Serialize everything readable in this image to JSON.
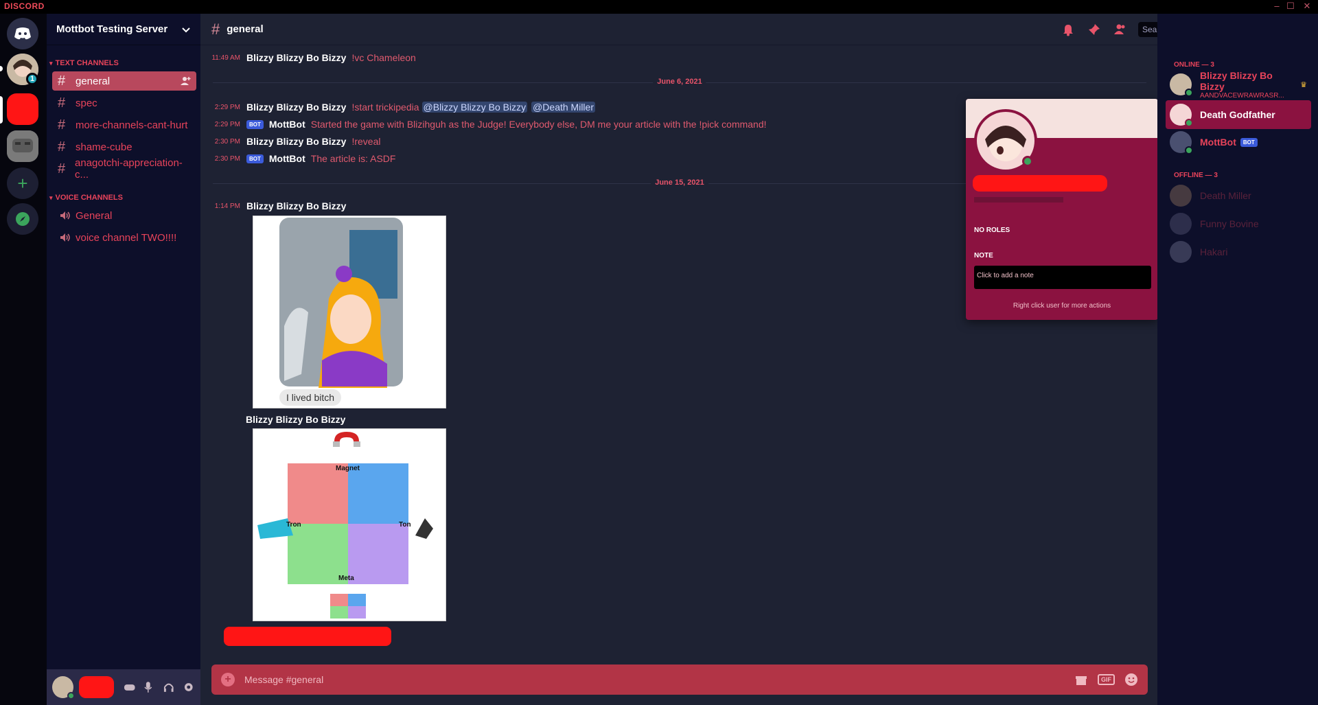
{
  "titlebar": {
    "app_name": "DISCORD"
  },
  "server": {
    "name": "Mottbot Testing Server",
    "mention_badge": "1"
  },
  "sidebar": {
    "text_category": "TEXT CHANNELS",
    "text_channels": [
      "general",
      "spec",
      "more-channels-cant-hurt",
      "shame-cube",
      "anagotchi-appreciation-c..."
    ],
    "voice_category": "VOICE CHANNELS",
    "voice_channels": [
      "General",
      "voice channel TWO!!!!"
    ]
  },
  "channel_header": {
    "name": "general",
    "search_placeholder": "Search"
  },
  "messages": {
    "m0": {
      "time": "11:49 AM",
      "author": "Blizzy Blizzy Bo Bizzy",
      "text": "!vc Chameleon"
    },
    "divider1": "June 6, 2021",
    "m1": {
      "time": "2:29 PM",
      "author": "Blizzy Blizzy Bo Bizzy",
      "text": "!start trickipedia",
      "mention1": "@Blizzy Blizzy Bo Bizzy",
      "mention2": "@Death Miller"
    },
    "m2": {
      "time": "2:29 PM",
      "badge": "BOT",
      "author": "MottBot",
      "text": "Started the game with Blizihguh as the Judge! Everybody else, DM me your article with the !pick command!"
    },
    "m3": {
      "time": "2:30 PM",
      "author": "Blizzy Blizzy Bo Bizzy",
      "text": "!reveal"
    },
    "m4": {
      "time": "2:30 PM",
      "badge": "BOT",
      "author": "MottBot",
      "text": "The article is: ASDF"
    },
    "divider2": "June 15, 2021",
    "m5": {
      "time": "1:14 PM",
      "author": "Blizzy Blizzy Bo Bizzy",
      "image_caption": "I lived bitch"
    },
    "m6": {
      "author": "Blizzy Blizzy Bo Bizzy",
      "chart_labels": {
        "top": "Magnet",
        "left": "Tron",
        "right": "Ton",
        "bottom": "Meta"
      }
    }
  },
  "composer": {
    "placeholder": "Message #general"
  },
  "popout": {
    "no_roles": "NO ROLES",
    "note_label": "NOTE",
    "note_placeholder": "Click to add a note",
    "footer": "Right click user for more actions"
  },
  "members": {
    "online_header": "ONLINE — 3",
    "online": [
      {
        "name": "Blizzy Blizzy Bo Bizzy",
        "status": "AANDVACEWRAWRASR..."
      },
      {
        "name": "Death Godfather"
      },
      {
        "name": "MottBot",
        "badge": "BOT"
      }
    ],
    "offline_header": "OFFLINE — 3",
    "offline": [
      {
        "name": "Death Miller"
      },
      {
        "name": "Funny Bovine"
      },
      {
        "name": "Hakari"
      }
    ]
  },
  "colors": {
    "accent": "#e8435a",
    "rail": "#06060e",
    "sidebar": "#0d0f2a",
    "main": "#1e2233",
    "popout": "#8b1240",
    "composer": "#b23446"
  }
}
